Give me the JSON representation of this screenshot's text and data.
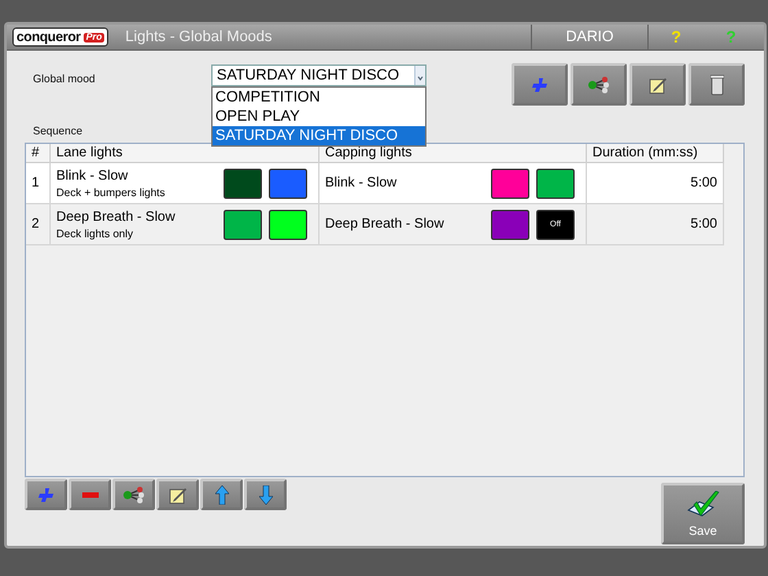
{
  "title_bar": {
    "logo": "conqueror",
    "logo_badge": "Pro",
    "title": "Lights - Global Moods",
    "user": "DARIO",
    "help_buttons": [
      "?",
      "?"
    ]
  },
  "global_mood": {
    "label": "Global mood",
    "value": "SATURDAY NIGHT DISCO",
    "expanded": true,
    "options": [
      {
        "label": "COMPETITION",
        "selected": false
      },
      {
        "label": "OPEN PLAY",
        "selected": false
      },
      {
        "label": "SATURDAY NIGHT DISCO",
        "selected": true
      }
    ]
  },
  "mood_actions": [
    {
      "kind": "add"
    },
    {
      "kind": "link"
    },
    {
      "kind": "edit"
    },
    {
      "kind": "delete"
    }
  ],
  "sequence": {
    "label": "Sequence",
    "columns": [
      "#",
      "Lane lights",
      "Capping lights",
      "Duration (mm:ss)"
    ],
    "rows": [
      {
        "index": "1",
        "lane_effect": "Blink - Slow",
        "lane_note": "Deck + bumpers lights",
        "lane_colors": [
          {
            "color": "#004a1c"
          },
          {
            "color": "#1a5cff"
          }
        ],
        "capping_effect": "Blink - Slow",
        "capping_colors": [
          {
            "color": "#ff0099"
          },
          {
            "color": "#00b548"
          }
        ],
        "duration": "5:00"
      },
      {
        "index": "2",
        "lane_effect": "Deep Breath - Slow",
        "lane_note": "Deck lights only",
        "lane_colors": [
          {
            "color": "#00b548"
          },
          {
            "color": "#00ff1e"
          }
        ],
        "capping_effect": "Deep Breath - Slow",
        "capping_colors": [
          {
            "color": "#8a00b8"
          },
          {
            "color": "#000000",
            "label": "Off"
          }
        ],
        "duration": "5:00"
      }
    ]
  },
  "sequence_actions": [
    {
      "kind": "add"
    },
    {
      "kind": "remove"
    },
    {
      "kind": "link"
    },
    {
      "kind": "edit"
    },
    {
      "kind": "up"
    },
    {
      "kind": "down"
    }
  ],
  "save_button": {
    "label": "Save"
  }
}
